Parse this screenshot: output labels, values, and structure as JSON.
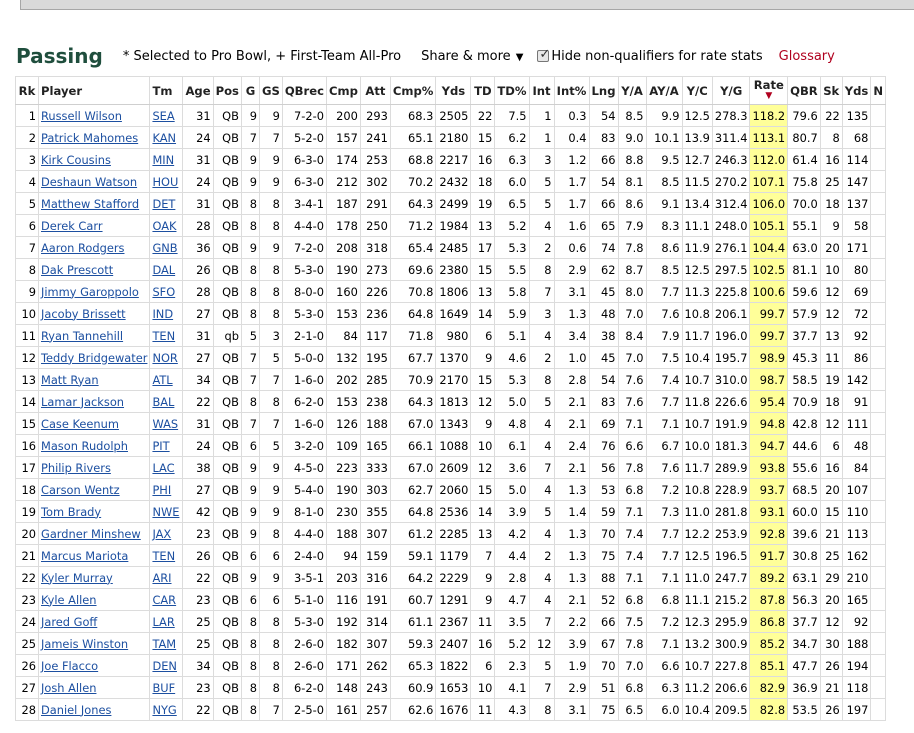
{
  "header": {
    "title": "Passing",
    "note": "* Selected to Pro Bowl, + First-Team All-Pro",
    "share_label": "Share & more",
    "share_caret": "▼",
    "hide_label": "Hide non-qualifiers for rate stats",
    "hide_checked": true,
    "glossary_label": "Glossary"
  },
  "table": {
    "columns": [
      "Rk",
      "Player",
      "Tm",
      "Age",
      "Pos",
      "G",
      "GS",
      "QBrec",
      "Cmp",
      "Att",
      "Cmp%",
      "Yds",
      "TD",
      "TD%",
      "Int",
      "Int%",
      "Lng",
      "Y/A",
      "AY/A",
      "Y/C",
      "Y/G",
      "Rate",
      "QBR",
      "Sk",
      "Yds",
      "N"
    ],
    "sort_column": "Rate",
    "sort_arrow": "▼",
    "rows": [
      [
        "1",
        "Russell Wilson",
        "SEA",
        "31",
        "QB",
        "9",
        "9",
        "7-2-0",
        "200",
        "293",
        "68.3",
        "2505",
        "22",
        "7.5",
        "1",
        "0.3",
        "54",
        "8.5",
        "9.9",
        "12.5",
        "278.3",
        "118.2",
        "79.6",
        "22",
        "135"
      ],
      [
        "2",
        "Patrick Mahomes",
        "KAN",
        "24",
        "QB",
        "7",
        "7",
        "5-2-0",
        "157",
        "241",
        "65.1",
        "2180",
        "15",
        "6.2",
        "1",
        "0.4",
        "83",
        "9.0",
        "10.1",
        "13.9",
        "311.4",
        "113.1",
        "80.7",
        "8",
        "68"
      ],
      [
        "3",
        "Kirk Cousins",
        "MIN",
        "31",
        "QB",
        "9",
        "9",
        "6-3-0",
        "174",
        "253",
        "68.8",
        "2217",
        "16",
        "6.3",
        "3",
        "1.2",
        "66",
        "8.8",
        "9.5",
        "12.7",
        "246.3",
        "112.0",
        "61.4",
        "16",
        "114"
      ],
      [
        "4",
        "Deshaun Watson",
        "HOU",
        "24",
        "QB",
        "9",
        "9",
        "6-3-0",
        "212",
        "302",
        "70.2",
        "2432",
        "18",
        "6.0",
        "5",
        "1.7",
        "54",
        "8.1",
        "8.5",
        "11.5",
        "270.2",
        "107.1",
        "75.8",
        "25",
        "147"
      ],
      [
        "5",
        "Matthew Stafford",
        "DET",
        "31",
        "QB",
        "8",
        "8",
        "3-4-1",
        "187",
        "291",
        "64.3",
        "2499",
        "19",
        "6.5",
        "5",
        "1.7",
        "66",
        "8.6",
        "9.1",
        "13.4",
        "312.4",
        "106.0",
        "70.0",
        "18",
        "137"
      ],
      [
        "6",
        "Derek Carr",
        "OAK",
        "28",
        "QB",
        "8",
        "8",
        "4-4-0",
        "178",
        "250",
        "71.2",
        "1984",
        "13",
        "5.2",
        "4",
        "1.6",
        "65",
        "7.9",
        "8.3",
        "11.1",
        "248.0",
        "105.1",
        "55.1",
        "9",
        "58"
      ],
      [
        "7",
        "Aaron Rodgers",
        "GNB",
        "36",
        "QB",
        "9",
        "9",
        "7-2-0",
        "208",
        "318",
        "65.4",
        "2485",
        "17",
        "5.3",
        "2",
        "0.6",
        "74",
        "7.8",
        "8.6",
        "11.9",
        "276.1",
        "104.4",
        "63.0",
        "20",
        "171"
      ],
      [
        "8",
        "Dak Prescott",
        "DAL",
        "26",
        "QB",
        "8",
        "8",
        "5-3-0",
        "190",
        "273",
        "69.6",
        "2380",
        "15",
        "5.5",
        "8",
        "2.9",
        "62",
        "8.7",
        "8.5",
        "12.5",
        "297.5",
        "102.5",
        "81.1",
        "10",
        "80"
      ],
      [
        "9",
        "Jimmy Garoppolo",
        "SFO",
        "28",
        "QB",
        "8",
        "8",
        "8-0-0",
        "160",
        "226",
        "70.8",
        "1806",
        "13",
        "5.8",
        "7",
        "3.1",
        "45",
        "8.0",
        "7.7",
        "11.3",
        "225.8",
        "100.6",
        "59.6",
        "12",
        "69"
      ],
      [
        "10",
        "Jacoby Brissett",
        "IND",
        "27",
        "QB",
        "8",
        "8",
        "5-3-0",
        "153",
        "236",
        "64.8",
        "1649",
        "14",
        "5.9",
        "3",
        "1.3",
        "48",
        "7.0",
        "7.6",
        "10.8",
        "206.1",
        "99.7",
        "57.9",
        "12",
        "72"
      ],
      [
        "11",
        "Ryan Tannehill",
        "TEN",
        "31",
        "qb",
        "5",
        "3",
        "2-1-0",
        "84",
        "117",
        "71.8",
        "980",
        "6",
        "5.1",
        "4",
        "3.4",
        "38",
        "8.4",
        "7.9",
        "11.7",
        "196.0",
        "99.7",
        "37.7",
        "13",
        "92"
      ],
      [
        "12",
        "Teddy Bridgewater",
        "NOR",
        "27",
        "QB",
        "7",
        "5",
        "5-0-0",
        "132",
        "195",
        "67.7",
        "1370",
        "9",
        "4.6",
        "2",
        "1.0",
        "45",
        "7.0",
        "7.5",
        "10.4",
        "195.7",
        "98.9",
        "45.3",
        "11",
        "86"
      ],
      [
        "13",
        "Matt Ryan",
        "ATL",
        "34",
        "QB",
        "7",
        "7",
        "1-6-0",
        "202",
        "285",
        "70.9",
        "2170",
        "15",
        "5.3",
        "8",
        "2.8",
        "54",
        "7.6",
        "7.4",
        "10.7",
        "310.0",
        "98.7",
        "58.5",
        "19",
        "142"
      ],
      [
        "14",
        "Lamar Jackson",
        "BAL",
        "22",
        "QB",
        "8",
        "8",
        "6-2-0",
        "153",
        "238",
        "64.3",
        "1813",
        "12",
        "5.0",
        "5",
        "2.1",
        "83",
        "7.6",
        "7.7",
        "11.8",
        "226.6",
        "95.4",
        "70.9",
        "18",
        "91"
      ],
      [
        "15",
        "Case Keenum",
        "WAS",
        "31",
        "QB",
        "7",
        "7",
        "1-6-0",
        "126",
        "188",
        "67.0",
        "1343",
        "9",
        "4.8",
        "4",
        "2.1",
        "69",
        "7.1",
        "7.1",
        "10.7",
        "191.9",
        "94.8",
        "42.8",
        "12",
        "111"
      ],
      [
        "16",
        "Mason Rudolph",
        "PIT",
        "24",
        "QB",
        "6",
        "5",
        "3-2-0",
        "109",
        "165",
        "66.1",
        "1088",
        "10",
        "6.1",
        "4",
        "2.4",
        "76",
        "6.6",
        "6.7",
        "10.0",
        "181.3",
        "94.7",
        "44.6",
        "6",
        "48"
      ],
      [
        "17",
        "Philip Rivers",
        "LAC",
        "38",
        "QB",
        "9",
        "9",
        "4-5-0",
        "223",
        "333",
        "67.0",
        "2609",
        "12",
        "3.6",
        "7",
        "2.1",
        "56",
        "7.8",
        "7.6",
        "11.7",
        "289.9",
        "93.8",
        "55.6",
        "16",
        "84"
      ],
      [
        "18",
        "Carson Wentz",
        "PHI",
        "27",
        "QB",
        "9",
        "9",
        "5-4-0",
        "190",
        "303",
        "62.7",
        "2060",
        "15",
        "5.0",
        "4",
        "1.3",
        "53",
        "6.8",
        "7.2",
        "10.8",
        "228.9",
        "93.7",
        "68.5",
        "20",
        "107"
      ],
      [
        "19",
        "Tom Brady",
        "NWE",
        "42",
        "QB",
        "9",
        "9",
        "8-1-0",
        "230",
        "355",
        "64.8",
        "2536",
        "14",
        "3.9",
        "5",
        "1.4",
        "59",
        "7.1",
        "7.3",
        "11.0",
        "281.8",
        "93.1",
        "60.0",
        "15",
        "110"
      ],
      [
        "20",
        "Gardner Minshew",
        "JAX",
        "23",
        "QB",
        "9",
        "8",
        "4-4-0",
        "188",
        "307",
        "61.2",
        "2285",
        "13",
        "4.2",
        "4",
        "1.3",
        "70",
        "7.4",
        "7.7",
        "12.2",
        "253.9",
        "92.8",
        "39.6",
        "21",
        "113"
      ],
      [
        "21",
        "Marcus Mariota",
        "TEN",
        "26",
        "QB",
        "6",
        "6",
        "2-4-0",
        "94",
        "159",
        "59.1",
        "1179",
        "7",
        "4.4",
        "2",
        "1.3",
        "75",
        "7.4",
        "7.7",
        "12.5",
        "196.5",
        "91.7",
        "30.8",
        "25",
        "162"
      ],
      [
        "22",
        "Kyler Murray",
        "ARI",
        "22",
        "QB",
        "9",
        "9",
        "3-5-1",
        "203",
        "316",
        "64.2",
        "2229",
        "9",
        "2.8",
        "4",
        "1.3",
        "88",
        "7.1",
        "7.1",
        "11.0",
        "247.7",
        "89.2",
        "63.1",
        "29",
        "210"
      ],
      [
        "23",
        "Kyle Allen",
        "CAR",
        "23",
        "QB",
        "6",
        "6",
        "5-1-0",
        "116",
        "191",
        "60.7",
        "1291",
        "9",
        "4.7",
        "4",
        "2.1",
        "52",
        "6.8",
        "6.8",
        "11.1",
        "215.2",
        "87.8",
        "56.3",
        "20",
        "165"
      ],
      [
        "24",
        "Jared Goff",
        "LAR",
        "25",
        "QB",
        "8",
        "8",
        "5-3-0",
        "192",
        "314",
        "61.1",
        "2367",
        "11",
        "3.5",
        "7",
        "2.2",
        "66",
        "7.5",
        "7.2",
        "12.3",
        "295.9",
        "86.8",
        "37.7",
        "12",
        "92"
      ],
      [
        "25",
        "Jameis Winston",
        "TAM",
        "25",
        "QB",
        "8",
        "8",
        "2-6-0",
        "182",
        "307",
        "59.3",
        "2407",
        "16",
        "5.2",
        "12",
        "3.9",
        "67",
        "7.8",
        "7.1",
        "13.2",
        "300.9",
        "85.2",
        "34.7",
        "30",
        "188"
      ],
      [
        "26",
        "Joe Flacco",
        "DEN",
        "34",
        "QB",
        "8",
        "8",
        "2-6-0",
        "171",
        "262",
        "65.3",
        "1822",
        "6",
        "2.3",
        "5",
        "1.9",
        "70",
        "7.0",
        "6.6",
        "10.7",
        "227.8",
        "85.1",
        "47.7",
        "26",
        "194"
      ],
      [
        "27",
        "Josh Allen",
        "BUF",
        "23",
        "QB",
        "8",
        "8",
        "6-2-0",
        "148",
        "243",
        "60.9",
        "1653",
        "10",
        "4.1",
        "7",
        "2.9",
        "51",
        "6.8",
        "6.3",
        "11.2",
        "206.6",
        "82.9",
        "36.9",
        "21",
        "118"
      ],
      [
        "28",
        "Daniel Jones",
        "NYG",
        "22",
        "QB",
        "8",
        "7",
        "2-5-0",
        "161",
        "257",
        "62.6",
        "1676",
        "11",
        "4.3",
        "8",
        "3.1",
        "75",
        "6.5",
        "6.0",
        "10.4",
        "209.5",
        "82.8",
        "53.5",
        "26",
        "197"
      ]
    ]
  }
}
